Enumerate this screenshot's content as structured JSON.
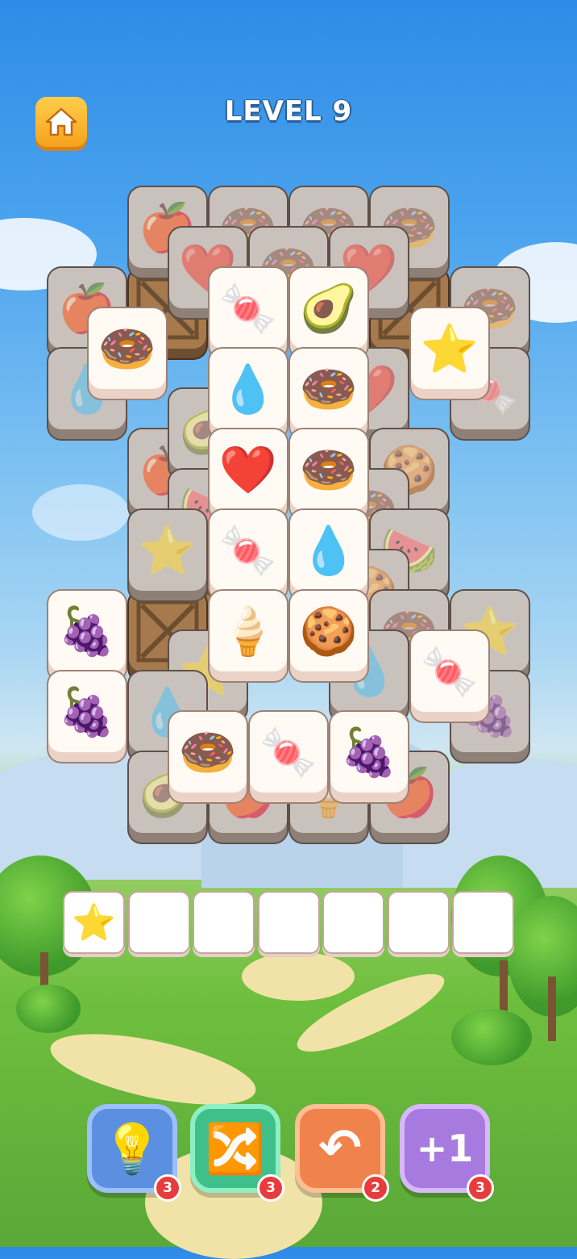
{
  "header": {
    "level_title": "LEVEL 9"
  },
  "home_button": {
    "icon": "home-icon"
  },
  "board": {
    "tiles": [
      {
        "id": "t1",
        "icon": "apple-icon",
        "glyph": "🍎",
        "state": "covered"
      },
      {
        "id": "t2",
        "icon": "donut-icon",
        "glyph": "🍩",
        "state": "covered"
      },
      {
        "id": "t3",
        "icon": "donut-icon",
        "glyph": "🍩",
        "state": "covered"
      },
      {
        "id": "t4",
        "icon": "donut-icon",
        "glyph": "🍩",
        "state": "covered"
      },
      {
        "id": "t5",
        "icon": "heart-icon",
        "glyph": "❤️",
        "state": "covered"
      },
      {
        "id": "t6",
        "icon": "donut-icon",
        "glyph": "🍩",
        "state": "covered"
      },
      {
        "id": "t7",
        "icon": "heart-icon",
        "glyph": "❤️",
        "state": "covered"
      },
      {
        "id": "t8",
        "icon": "apple-icon",
        "glyph": "🍎",
        "state": "covered"
      },
      {
        "id": "t9",
        "icon": "crate-icon",
        "glyph": "",
        "state": "crate"
      },
      {
        "id": "t10",
        "icon": "crate-icon",
        "glyph": "",
        "state": "crate"
      },
      {
        "id": "t11",
        "icon": "donut-icon",
        "glyph": "🍩",
        "state": "covered"
      },
      {
        "id": "t12",
        "icon": "water-drop-icon",
        "glyph": "💧",
        "state": "covered"
      },
      {
        "id": "t13",
        "icon": "candy-icon",
        "glyph": "🍬",
        "state": "covered"
      },
      {
        "id": "t14",
        "icon": "apple-icon",
        "glyph": "🍎",
        "state": "covered"
      },
      {
        "id": "t15",
        "icon": "avocado-icon",
        "glyph": "🥑",
        "state": "covered"
      },
      {
        "id": "t16",
        "icon": "heart-icon",
        "glyph": "❤️",
        "state": "covered"
      },
      {
        "id": "t17",
        "icon": "cookie-icon",
        "glyph": "🍪",
        "state": "covered"
      },
      {
        "id": "t18",
        "icon": "watermelon-icon",
        "glyph": "🍉",
        "state": "covered"
      },
      {
        "id": "t19",
        "icon": "donut-icon",
        "glyph": "🍩",
        "state": "covered"
      },
      {
        "id": "t20",
        "icon": "star-icon",
        "glyph": "⭐",
        "state": "covered"
      },
      {
        "id": "t21",
        "icon": "watermelon-icon",
        "glyph": "🍉",
        "state": "covered"
      },
      {
        "id": "t22",
        "icon": "crate-icon",
        "glyph": "",
        "state": "crate"
      },
      {
        "id": "t23",
        "icon": "cookie-icon",
        "glyph": "🍪",
        "state": "covered"
      },
      {
        "id": "t24",
        "icon": "crate-icon",
        "glyph": "",
        "state": "crate"
      },
      {
        "id": "t25",
        "icon": "donut-icon",
        "glyph": "🍩",
        "state": "covered"
      },
      {
        "id": "t26",
        "icon": "star-icon",
        "glyph": "⭐",
        "state": "covered"
      },
      {
        "id": "t27",
        "icon": "star-icon",
        "glyph": "⭐",
        "state": "covered"
      },
      {
        "id": "t28",
        "icon": "water-drop-icon",
        "glyph": "💧",
        "state": "covered"
      },
      {
        "id": "t29",
        "icon": "water-drop-icon",
        "glyph": "💧",
        "state": "covered"
      },
      {
        "id": "t30",
        "icon": "grapes-icon",
        "glyph": "🍇",
        "state": "covered"
      },
      {
        "id": "t31",
        "icon": "avocado-icon",
        "glyph": "🥑",
        "state": "covered"
      },
      {
        "id": "t32",
        "icon": "apple-icon",
        "glyph": "🍎",
        "state": "covered"
      },
      {
        "id": "t33",
        "icon": "ice-cream-icon",
        "glyph": "🍦",
        "state": "covered"
      },
      {
        "id": "t34",
        "icon": "apple-icon",
        "glyph": "🍎",
        "state": "covered"
      },
      {
        "id": "o1",
        "icon": "donut-icon",
        "glyph": "🍩",
        "state": "open"
      },
      {
        "id": "o2",
        "icon": "candy-icon",
        "glyph": "🍬",
        "state": "open"
      },
      {
        "id": "o3",
        "icon": "avocado-icon",
        "glyph": "🥑",
        "state": "open"
      },
      {
        "id": "o4",
        "icon": "star-icon",
        "glyph": "⭐",
        "state": "open"
      },
      {
        "id": "o5",
        "icon": "water-drop-icon",
        "glyph": "💧",
        "state": "open"
      },
      {
        "id": "o6",
        "icon": "donut-icon",
        "glyph": "🍩",
        "state": "open"
      },
      {
        "id": "o7",
        "icon": "heart-icon",
        "glyph": "❤️",
        "state": "open"
      },
      {
        "id": "o8",
        "icon": "donut-icon",
        "glyph": "🍩",
        "state": "open"
      },
      {
        "id": "o9",
        "icon": "candy-icon",
        "glyph": "🍬",
        "state": "open"
      },
      {
        "id": "o10",
        "icon": "water-drop-icon",
        "glyph": "💧",
        "state": "open"
      },
      {
        "id": "o11",
        "icon": "grapes-icon",
        "glyph": "🍇",
        "state": "open"
      },
      {
        "id": "o12",
        "icon": "ice-cream-icon",
        "glyph": "🍦",
        "state": "open"
      },
      {
        "id": "o13",
        "icon": "cookie-icon",
        "glyph": "🍪",
        "state": "open"
      },
      {
        "id": "o14",
        "icon": "candy-icon",
        "glyph": "🍬",
        "state": "open"
      },
      {
        "id": "o15",
        "icon": "grapes-icon",
        "glyph": "🍇",
        "state": "open"
      },
      {
        "id": "o16",
        "icon": "donut-icon",
        "glyph": "🍩",
        "state": "open"
      },
      {
        "id": "o17",
        "icon": "candy-icon",
        "glyph": "🍬",
        "state": "open"
      },
      {
        "id": "o18",
        "icon": "grapes-icon",
        "glyph": "🍇",
        "state": "open"
      }
    ]
  },
  "tray": {
    "slots": [
      {
        "icon": "star-icon",
        "glyph": "⭐"
      },
      {
        "icon": "",
        "glyph": ""
      },
      {
        "icon": "",
        "glyph": ""
      },
      {
        "icon": "",
        "glyph": ""
      },
      {
        "icon": "",
        "glyph": ""
      },
      {
        "icon": "",
        "glyph": ""
      },
      {
        "icon": "",
        "glyph": ""
      }
    ]
  },
  "powerups": [
    {
      "name": "hint",
      "icon": "lightbulb-icon",
      "glyph": "💡",
      "count": "3",
      "color": "#5b8fe0",
      "border": "#9cc0ff"
    },
    {
      "name": "shuffle",
      "icon": "shuffle-icon",
      "glyph": "🔀",
      "count": "3",
      "color": "#3fc08a",
      "border": "#8ef0c2"
    },
    {
      "name": "undo",
      "icon": "undo-icon",
      "glyph": "↶",
      "count": "2",
      "color": "#f0834b",
      "border": "#ffbe93"
    },
    {
      "name": "add-slot",
      "icon": "plus-one-icon",
      "glyph": "+1",
      "count": "3",
      "color": "#a77ae0",
      "border": "#d6b8ff"
    }
  ]
}
